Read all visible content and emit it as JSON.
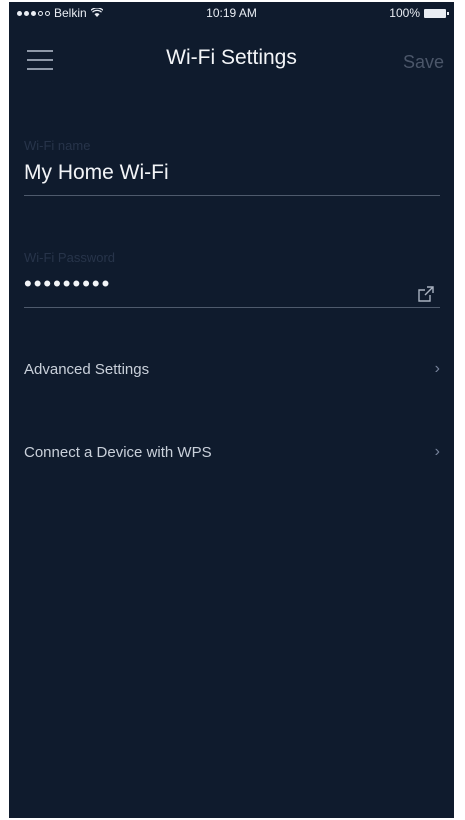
{
  "status_bar": {
    "carrier": "Belkin",
    "time": "10:19 AM",
    "battery": "100%"
  },
  "header": {
    "title": "Wi-Fi Settings",
    "save_label": "Save",
    "menu_icon": "hamburger-menu-icon"
  },
  "wifi_name": {
    "label": "Wi-Fi name",
    "value": "My Home Wi-Fi"
  },
  "wifi_password": {
    "label": "Wi-Fi Password",
    "value": "•••••••••",
    "share_icon": "share-icon"
  },
  "menu": {
    "advanced": "Advanced Settings",
    "wps": "Connect a Device with WPS"
  },
  "colors": {
    "background": "#0f1b2d",
    "text": "#ffffff",
    "muted": "#4b5669"
  }
}
